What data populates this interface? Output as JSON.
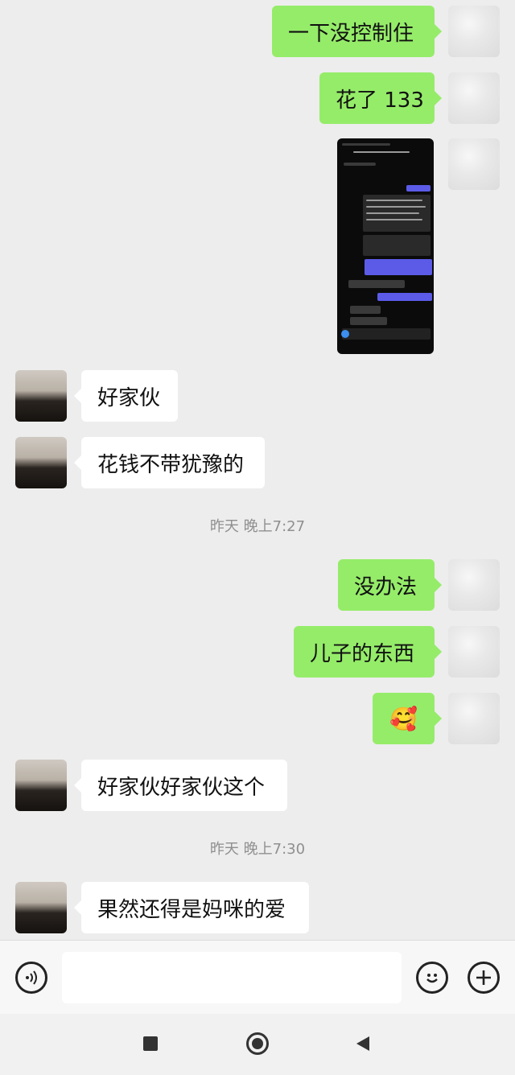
{
  "messages": [
    {
      "side": "self",
      "text": "一下没控制住"
    },
    {
      "side": "self",
      "text": "花了 133"
    },
    {
      "side": "self",
      "type": "image"
    },
    {
      "side": "other",
      "text": "好家伙"
    },
    {
      "side": "other",
      "text": "花钱不带犹豫的"
    },
    {
      "type": "time",
      "text": "昨天 晚上7:27"
    },
    {
      "side": "self",
      "text": "没办法"
    },
    {
      "side": "self",
      "text": "儿子的东西"
    },
    {
      "side": "self",
      "text": "🥰"
    },
    {
      "side": "other",
      "text": "好家伙好家伙这个"
    },
    {
      "type": "time",
      "text": "昨天 晚上7:30"
    },
    {
      "side": "other",
      "text": "果然还得是妈咪的爱"
    }
  ],
  "input": {
    "value": "",
    "placeholder": ""
  },
  "colors": {
    "self_bubble": "#95ec69",
    "other_bubble": "#ffffff",
    "background": "#ededed"
  }
}
